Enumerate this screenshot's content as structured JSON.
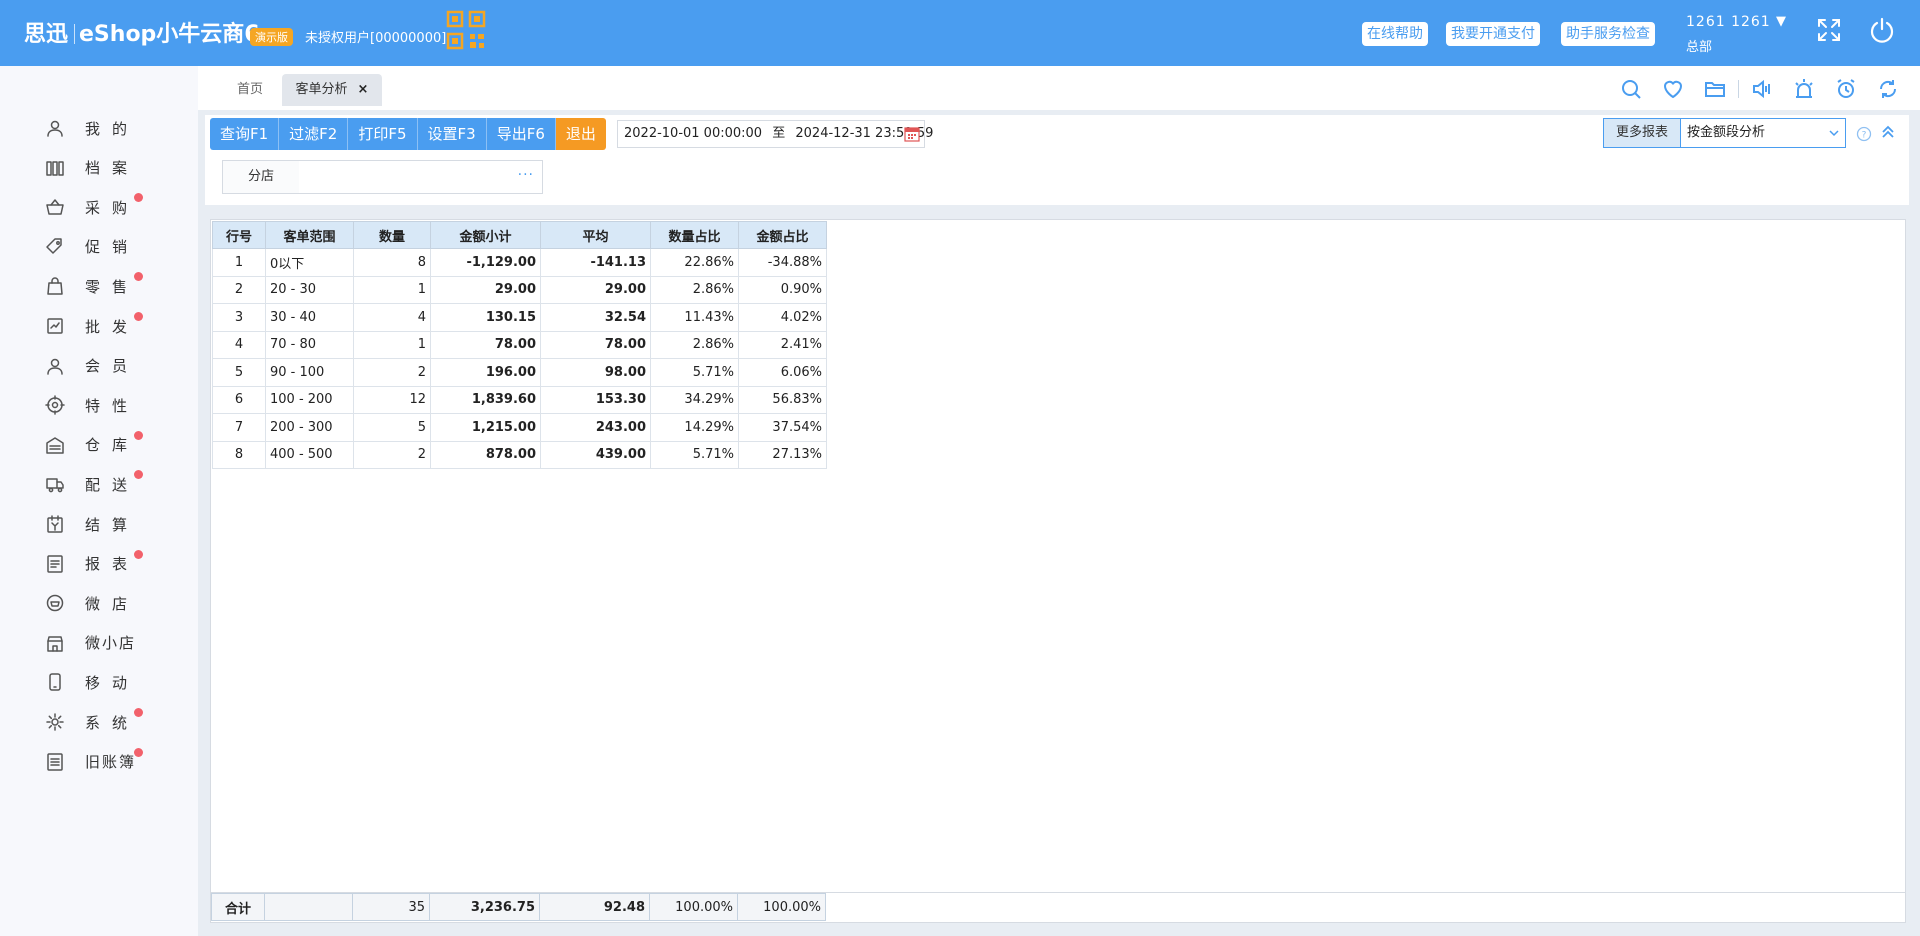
{
  "header": {
    "logo_brand": "思迅",
    "logo_product": "eShop小牛云商6",
    "demo_badge": "演示版",
    "unauth_text": "未授权用户[00000000]",
    "buttons": [
      "在线帮助",
      "我要开通支付",
      "助手服务检查"
    ],
    "user_name": "1261 1261",
    "user_arrow": "▼",
    "user_store": "总部"
  },
  "sidebar": {
    "items": [
      {
        "label": "我的",
        "icon": "user-icon",
        "dot": false
      },
      {
        "label": "档案",
        "icon": "archive-icon",
        "dot": false
      },
      {
        "label": "采购",
        "icon": "basket-icon",
        "dot": true
      },
      {
        "label": "促销",
        "icon": "tag-icon",
        "dot": false
      },
      {
        "label": "零售",
        "icon": "bag-icon",
        "dot": true
      },
      {
        "label": "批发",
        "icon": "wholesale-icon",
        "dot": true
      },
      {
        "label": "会员",
        "icon": "member-icon",
        "dot": false
      },
      {
        "label": "特性",
        "icon": "feature-icon",
        "dot": false
      },
      {
        "label": "仓库",
        "icon": "warehouse-icon",
        "dot": true
      },
      {
        "label": "配送",
        "icon": "truck-icon",
        "dot": true
      },
      {
        "label": "结算",
        "icon": "settle-icon",
        "dot": false
      },
      {
        "label": "报表",
        "icon": "report-icon",
        "dot": true
      },
      {
        "label": "微店",
        "icon": "wechat-shop-icon",
        "dot": false
      },
      {
        "label": "微小店",
        "icon": "mini-shop-icon",
        "dot": false
      },
      {
        "label": "移动",
        "icon": "mobile-icon",
        "dot": false
      },
      {
        "label": "系统",
        "icon": "gear-icon",
        "dot": true
      },
      {
        "label": "旧账簿",
        "icon": "ledger-icon",
        "dot": true
      }
    ]
  },
  "tabs": {
    "home": "首页",
    "current": "客单分析",
    "close": "×"
  },
  "toolbar": {
    "query": "查询F1",
    "filter": "过滤F2",
    "print": "打印F5",
    "settings": "设置F3",
    "export": "导出F6",
    "exit": "退出",
    "date_start": "2022-10-01 00:00:00",
    "date_to": "至",
    "date_end": "2024-12-31 23:59:59",
    "store_label": "分店",
    "store_value": "",
    "more_reports_label": "更多报表",
    "more_reports_value": "按金额段分析"
  },
  "table": {
    "columns": [
      "行号",
      "客单范围",
      "数量",
      "金额小计",
      "平均",
      "数量占比",
      "金额占比"
    ],
    "rows": [
      [
        "1",
        "0以下",
        "8",
        "-1,129.00",
        "-141.13",
        "22.86%",
        "-34.88%"
      ],
      [
        "2",
        "20 - 30",
        "1",
        "29.00",
        "29.00",
        "2.86%",
        "0.90%"
      ],
      [
        "3",
        "30 - 40",
        "4",
        "130.15",
        "32.54",
        "11.43%",
        "4.02%"
      ],
      [
        "4",
        "70 - 80",
        "1",
        "78.00",
        "78.00",
        "2.86%",
        "2.41%"
      ],
      [
        "5",
        "90 - 100",
        "2",
        "196.00",
        "98.00",
        "5.71%",
        "6.06%"
      ],
      [
        "6",
        "100 - 200",
        "12",
        "1,839.60",
        "153.30",
        "34.29%",
        "56.83%"
      ],
      [
        "7",
        "200 - 300",
        "5",
        "1,215.00",
        "243.00",
        "14.29%",
        "37.54%"
      ],
      [
        "8",
        "400 - 500",
        "2",
        "878.00",
        "439.00",
        "5.71%",
        "27.13%"
      ]
    ],
    "footer": [
      "合计",
      "",
      "35",
      "3,236.75",
      "92.48",
      "100.00%",
      "100.00%"
    ]
  },
  "colors": {
    "header_bg": "#4a9df0",
    "accent_orange": "#f59a23",
    "badge_dot": "#f2616b",
    "table_header_bg": "#d8e8f7"
  }
}
